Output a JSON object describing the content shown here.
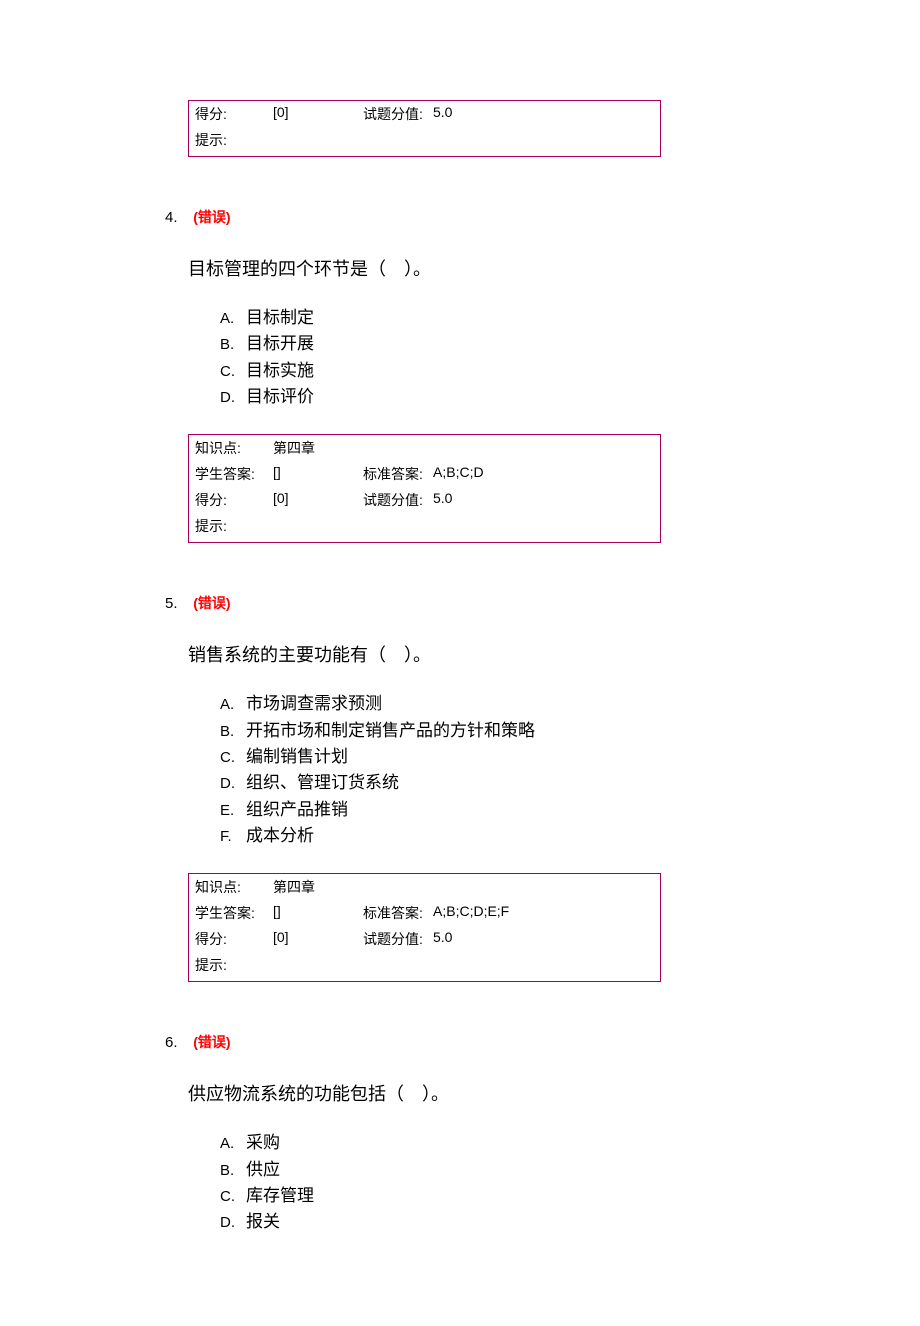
{
  "labels": {
    "knowledge": "知识点:",
    "student_answer": "学生答案:",
    "standard_answer": "标准答案:",
    "score": "得分:",
    "item_score": "试题分值:",
    "hint": "提示:"
  },
  "partial": {
    "score_value": "[0]",
    "item_score_value": "5.0"
  },
  "questions": [
    {
      "number": "4.",
      "status": "(错误)",
      "stem": "目标管理的四个环节是（　）。",
      "options": [
        {
          "letter": "A.",
          "text": "目标制定"
        },
        {
          "letter": "B.",
          "text": "目标开展"
        },
        {
          "letter": "C.",
          "text": "目标实施"
        },
        {
          "letter": "D.",
          "text": "目标评价"
        }
      ],
      "knowledge": "第四章",
      "student_answer": "[]",
      "standard_answer": "A;B;C;D",
      "score_value": "[0]",
      "item_score_value": "5.0",
      "hint_value": ""
    },
    {
      "number": "5.",
      "status": "(错误)",
      "stem": "销售系统的主要功能有（　）。",
      "options": [
        {
          "letter": "A.",
          "text": "市场调查需求预测"
        },
        {
          "letter": "B.",
          "text": "开拓市场和制定销售产品的方针和策略"
        },
        {
          "letter": "C.",
          "text": "编制销售计划"
        },
        {
          "letter": "D.",
          "text": "组织、管理订货系统"
        },
        {
          "letter": "E.",
          "text": "组织产品推销"
        },
        {
          "letter": "F.",
          "text": "成本分析"
        }
      ],
      "knowledge": "第四章",
      "student_answer": "[]",
      "standard_answer": "A;B;C;D;E;F",
      "score_value": "[0]",
      "item_score_value": "5.0",
      "hint_value": ""
    },
    {
      "number": "6.",
      "status": "(错误)",
      "stem": "供应物流系统的功能包括（　）。",
      "options": [
        {
          "letter": "A.",
          "text": "采购"
        },
        {
          "letter": "B.",
          "text": "供应"
        },
        {
          "letter": "C.",
          "text": "库存管理"
        },
        {
          "letter": "D.",
          "text": "报关"
        }
      ]
    }
  ]
}
